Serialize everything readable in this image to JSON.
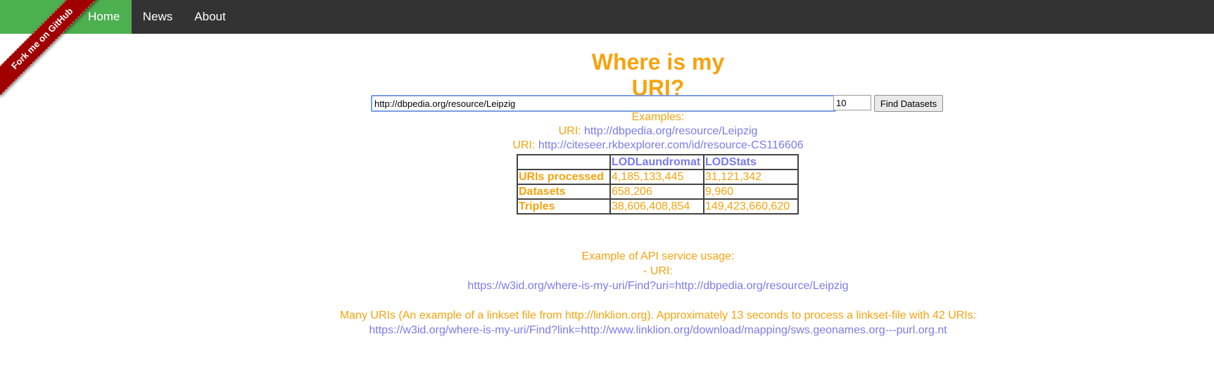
{
  "nav": {
    "items": [
      {
        "label": "Home",
        "active": true
      },
      {
        "label": "News",
        "active": false
      },
      {
        "label": "About",
        "active": false
      }
    ]
  },
  "ribbon": {
    "label": "Fork me on GitHub"
  },
  "page": {
    "title": "Where is my URI?"
  },
  "search": {
    "uri_value": "http://dbpedia.org/resource/Leipzig",
    "count_value": "10",
    "button_label": "Find Datasets"
  },
  "examples": {
    "heading": "Examples:",
    "items": [
      {
        "prefix": "URI:",
        "link": "http://dbpedia.org/resource/Leipzig"
      },
      {
        "prefix": "URI:",
        "link": "http://citeseer.rkbexplorer.com/id/resource-CS116606"
      }
    ]
  },
  "stats_table": {
    "headers": [
      "",
      "LODLaundromat",
      "LODStats"
    ],
    "rows": [
      {
        "label": "URIs processed",
        "values": [
          "4,185,133,445",
          "31,121,342"
        ]
      },
      {
        "label": "Datasets",
        "values": [
          "658,206",
          "9,960"
        ]
      },
      {
        "label": "Triples",
        "values": [
          "38,606,408,854",
          "149,423,660,620"
        ]
      }
    ]
  },
  "api": {
    "heading": "Example of API service usage:",
    "uri_label": "- URI:",
    "uri_link": "https://w3id.org/where-is-my-uri/Find?uri=http://dbpedia.org/resource/Leipzig",
    "many_text": "Many URIs (An example of a linkset file from http://linklion.org). Approximately 13 seconds to process a linkset-file with 42 URIs:",
    "many_link": "https://w3id.org/where-is-my-uri/Find?link=http://www.linklion.org/download/mapping/sws.geonames.org---purl.org.nt"
  },
  "colors": {
    "navbar": "#333333",
    "nav_active": "#4caf50",
    "accent_orange": "#f5a30f",
    "link_blue": "#7b7bea",
    "ribbon": "#a00000"
  }
}
